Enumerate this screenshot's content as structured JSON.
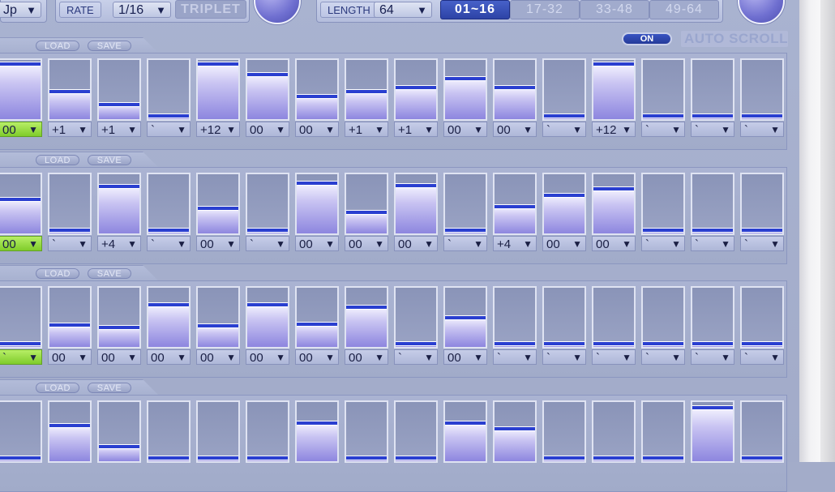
{
  "header": {
    "direction": {
      "value": "Jp",
      "arrow": "▼"
    },
    "rate": {
      "label": "RATE",
      "value": "1/16",
      "arrow": "▼"
    },
    "triplet_label": "TRIPLET",
    "length": {
      "label": "LENGTH",
      "value": "64",
      "arrow": "▼"
    },
    "pages": [
      "01~16",
      "17-32",
      "33-48",
      "49-64"
    ],
    "active_page": 0
  },
  "auto_scroll": {
    "toggle_label": "ON",
    "label": "AUTO SCROLL"
  },
  "buttons": {
    "load": "LOAD",
    "save": "SAVE"
  },
  "lanes": [
    {
      "levels": [
        0.93,
        0.47,
        0.25,
        0.05,
        0.93,
        0.75,
        0.38,
        0.47,
        0.53,
        0.68,
        0.53,
        0.05,
        0.93,
        0.05,
        0.05,
        0.05
      ],
      "values": [
        "00",
        "+1",
        "+1",
        "`",
        "+12",
        "00",
        "00",
        "+1",
        "+1",
        "00",
        "00",
        "`",
        "+12",
        "`",
        "`",
        "`"
      ],
      "green": [
        0
      ]
    },
    {
      "levels": [
        0.57,
        0.05,
        0.8,
        0.05,
        0.43,
        0.05,
        0.85,
        0.35,
        0.81,
        0.05,
        0.45,
        0.65,
        0.76,
        0.05,
        0.05,
        0.05
      ],
      "values": [
        "00",
        "`",
        "+4",
        "`",
        "00",
        "`",
        "00",
        "00",
        "00",
        "`",
        "+4",
        "00",
        "00",
        "`",
        "`",
        "`"
      ],
      "green": [
        0
      ]
    },
    {
      "levels": [
        0.05,
        0.37,
        0.33,
        0.71,
        0.35,
        0.71,
        0.39,
        0.67,
        0.05,
        0.49,
        0.05,
        0.05,
        0.05,
        0.05,
        0.05,
        0.05
      ],
      "values": [
        "`",
        "00",
        "00",
        "00",
        "00",
        "00",
        "00",
        "00",
        "`",
        "00",
        "`",
        "`",
        "`",
        "`",
        "`",
        "`"
      ],
      "green": [
        0
      ]
    },
    {
      "levels": [
        0.05,
        0.6,
        0.25,
        0.05,
        0.05,
        0.05,
        0.65,
        0.05,
        0.05,
        0.65,
        0.55,
        0.05,
        0.05,
        0.05,
        0.9,
        0.05
      ],
      "values": [],
      "green": []
    }
  ],
  "arrow": "▼"
}
